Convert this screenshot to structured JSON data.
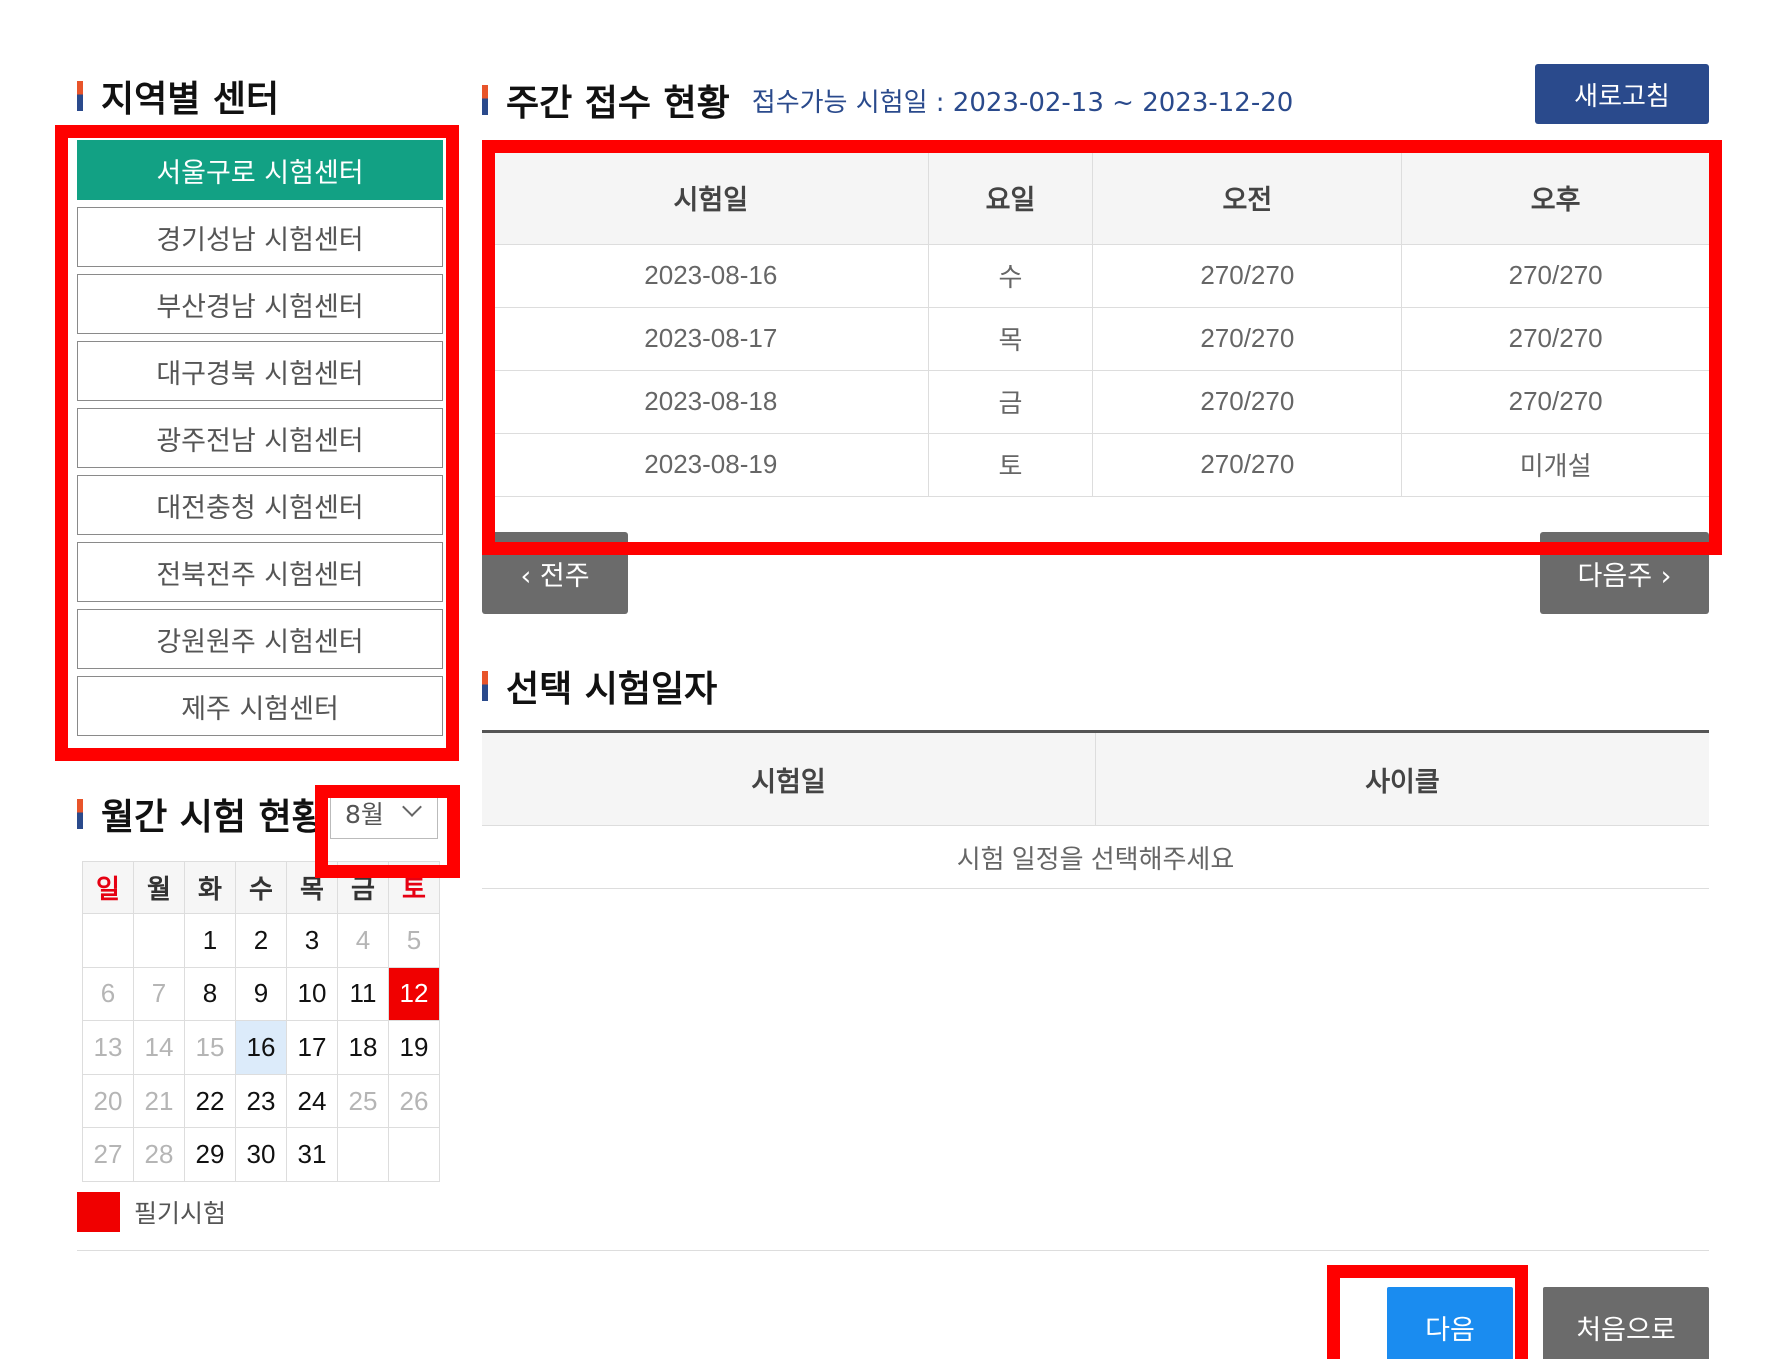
{
  "region_section": {
    "title": "지역별 센터",
    "items": [
      {
        "label": "서울구로 시험센터",
        "active": true
      },
      {
        "label": "경기성남 시험센터",
        "active": false
      },
      {
        "label": "부산경남 시험센터",
        "active": false
      },
      {
        "label": "대구경북 시험센터",
        "active": false
      },
      {
        "label": "광주전남 시험센터",
        "active": false
      },
      {
        "label": "대전충청 시험센터",
        "active": false
      },
      {
        "label": "전북전주 시험센터",
        "active": false
      },
      {
        "label": "강원원주 시험센터",
        "active": false
      },
      {
        "label": "제주 시험센터",
        "active": false
      }
    ]
  },
  "monthly_section": {
    "title": "월간 시험 현황",
    "month_select": "8월",
    "weekdays": [
      "일",
      "월",
      "화",
      "수",
      "목",
      "금",
      "토"
    ],
    "weeks": [
      [
        "",
        "",
        "1",
        "2",
        "3",
        "4",
        "5"
      ],
      [
        "6",
        "7",
        "8",
        "9",
        "10",
        "11",
        "12"
      ],
      [
        "13",
        "14",
        "15",
        "16",
        "17",
        "18",
        "19"
      ],
      [
        "20",
        "21",
        "22",
        "23",
        "24",
        "25",
        "26"
      ],
      [
        "27",
        "28",
        "29",
        "30",
        "31",
        "",
        ""
      ]
    ],
    "exam_dates": [
      "12"
    ],
    "selected_date": "16",
    "legend_label": "필기시험",
    "exam_color": "#f00000"
  },
  "weekly_section": {
    "title": "주간 접수 현황",
    "subtitle": "접수가능 시험일 : 2023-02-13 ~ 2023-12-20",
    "refresh_label": "새로고침",
    "headers": [
      "시험일",
      "요일",
      "오전",
      "오후"
    ],
    "rows": [
      [
        "2023-08-16",
        "수",
        "270/270",
        "270/270"
      ],
      [
        "2023-08-17",
        "목",
        "270/270",
        "270/270"
      ],
      [
        "2023-08-18",
        "금",
        "270/270",
        "270/270"
      ],
      [
        "2023-08-19",
        "토",
        "270/270",
        "미개설"
      ]
    ],
    "prev_label": "‹ 전주",
    "next_label": "다음주 ›"
  },
  "selected_section": {
    "title": "선택 시험일자",
    "headers": [
      "시험일",
      "사이클"
    ],
    "empty_message": "시험 일정을 선택해주세요"
  },
  "footer": {
    "next_label": "다음",
    "first_label": "처음으로"
  },
  "colors": {
    "active_green": "#12a184",
    "navy": "#2a4a8c",
    "primary_blue": "#1a8cf0",
    "gray_button": "#6b6b6b",
    "highlight_red": "#ff0000"
  }
}
